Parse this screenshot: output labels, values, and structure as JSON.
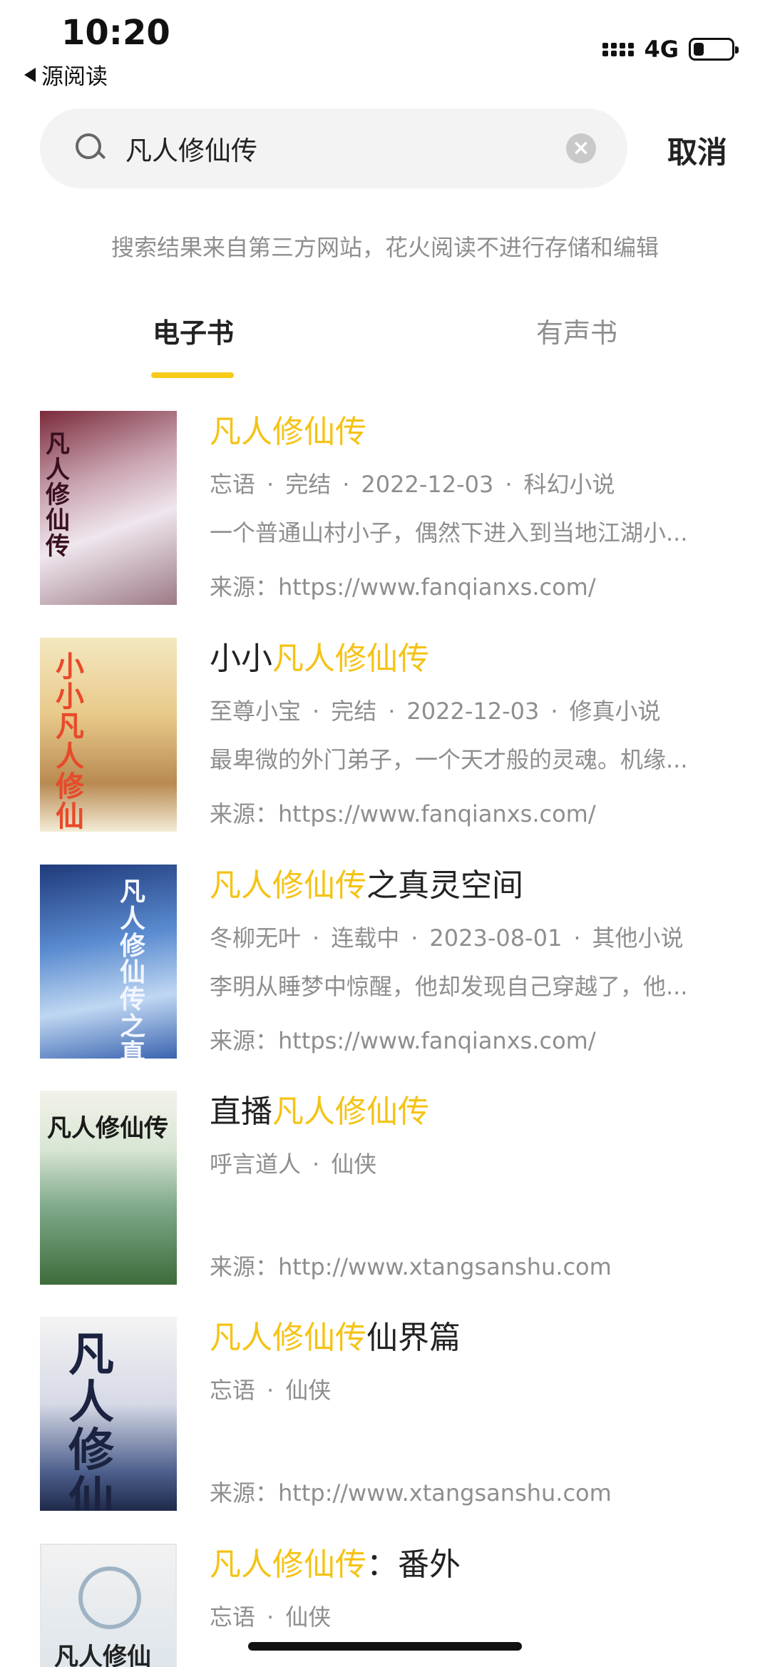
{
  "status_bar": {
    "time": "10:20",
    "back_app": "源阅读",
    "network": "4G",
    "battery_level": 0.2
  },
  "search": {
    "query": "凡人修仙传",
    "cancel_label": "取消"
  },
  "disclaimer": "搜索结果来自第三方网站，花火阅读不进行存储和编辑",
  "tabs": [
    {
      "label": "电子书",
      "active": true
    },
    {
      "label": "有声书",
      "active": false
    }
  ],
  "results": [
    {
      "title_pre": "",
      "title_hl": "凡人修仙传",
      "title_post": "",
      "author": "忘语",
      "status": "完结",
      "date": "2022-12-03",
      "category": "科幻小说",
      "desc": "一个普通山村小子，偶然下进入到当地江湖小...",
      "source": "来源：https://www.fanqianxs.com/",
      "cover_text": "凡人修仙传"
    },
    {
      "title_pre": "小小",
      "title_hl": "凡人修仙传",
      "title_post": "",
      "author": "至尊小宝",
      "status": "完结",
      "date": "2022-12-03",
      "category": "修真小说",
      "desc": "最卑微的外门弟子，一个天才般的灵魂。机缘...",
      "source": "来源：https://www.fanqianxs.com/",
      "cover_text": "小小凡人修仙传"
    },
    {
      "title_pre": "",
      "title_hl": "凡人修仙传",
      "title_post": "之真灵空间",
      "author": "冬柳无叶",
      "status": "连载中",
      "date": "2023-08-01",
      "category": "其他小说",
      "desc": "李明从睡梦中惊醒，他却发现自己穿越了，他...",
      "source": "来源：https://www.fanqianxs.com/",
      "cover_text": "凡人修仙传之真灵空间"
    },
    {
      "title_pre": "直播",
      "title_hl": "凡人修仙传",
      "title_post": "",
      "author": "呼言道人",
      "status": "",
      "date": "",
      "category": "仙侠",
      "desc": "",
      "source": "来源：http://www.xtangsanshu.com",
      "cover_text": "凡人修仙传"
    },
    {
      "title_pre": "",
      "title_hl": "凡人修仙传",
      "title_post": "仙界篇",
      "author": "忘语",
      "status": "",
      "date": "",
      "category": "仙侠",
      "desc": "",
      "source": "来源：http://www.xtangsanshu.com",
      "cover_text": "凡人修仙"
    },
    {
      "title_pre": "",
      "title_hl": "凡人修仙传",
      "title_post": "：番外",
      "author": "忘语",
      "status": "",
      "date": "",
      "category": "仙侠",
      "desc": "",
      "source": "",
      "cover_text": "凡人修仙"
    }
  ]
}
